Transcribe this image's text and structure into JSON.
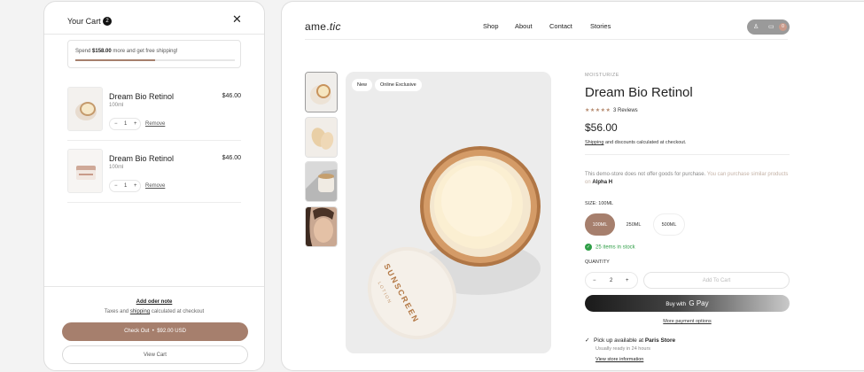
{
  "cart": {
    "title": "Your Cart",
    "count": "2",
    "close_icon": "close-icon",
    "shipping_prefix": "Spend",
    "shipping_amount": "$158.00",
    "shipping_suffix": "more and get free shipping!",
    "shipping_progress": 0.5,
    "items": [
      {
        "name": "Dream Bio Retinol",
        "size": "100ml",
        "price": "$46.00",
        "qty": "1",
        "remove": "Remove"
      },
      {
        "name": "Dream Bio Retinol",
        "size": "100ml",
        "price": "$46.00",
        "qty": "1",
        "remove": "Remove"
      }
    ],
    "order_note": "Add oder note",
    "taxes_prefix": "Taxes and",
    "taxes_link": "shipping",
    "taxes_suffix": "calculated at checkout",
    "checkout_label": "Check Out",
    "checkout_sep": "•",
    "checkout_total": "$92.00",
    "checkout_currency": "USD",
    "view_cart": "View Cart"
  },
  "store": {
    "logo_a": "ame.",
    "logo_b": "tic",
    "nav": [
      "Shop",
      "About",
      "Contact",
      "Stories"
    ],
    "cart_badge": "0",
    "badges": [
      "New",
      "Online Exclusive"
    ],
    "category": "MOISTURIZE",
    "title": "Dream Bio Retinol",
    "stars": "★★★★★",
    "reviews": "3 Reviews",
    "price": "$56.00",
    "shipping_note_link": "Shipping",
    "shipping_note_rest": "and discounts calculated at checkout.",
    "demo_text": "This demo-store does not offer goods for purchase.",
    "demo_link": "You can purchase similar products on",
    "demo_brand": "Alpha H",
    "size_label": "SIZE:",
    "size_value": "100ML",
    "sizes": [
      "100ML",
      "250ML",
      "500ML"
    ],
    "stock": "25 items in stock",
    "quantity_label": "QUANTITY",
    "qty_minus": "−",
    "qty_value": "2",
    "qty_plus": "+",
    "add_to_cart": "Add To Cart",
    "buy_with": "Buy with",
    "gpay": "G Pay",
    "more_payment": "More payment options",
    "pickup_prefix": "Pick up available at",
    "pickup_store": "Paris Store",
    "ready": "Usually ready in 24 hours",
    "store_info": "View store information",
    "jar_text_a": "SUNSCREEN",
    "jar_text_b": "LOTION",
    "accent": "#a67f6d",
    "stock_color": "#2e9e46"
  }
}
